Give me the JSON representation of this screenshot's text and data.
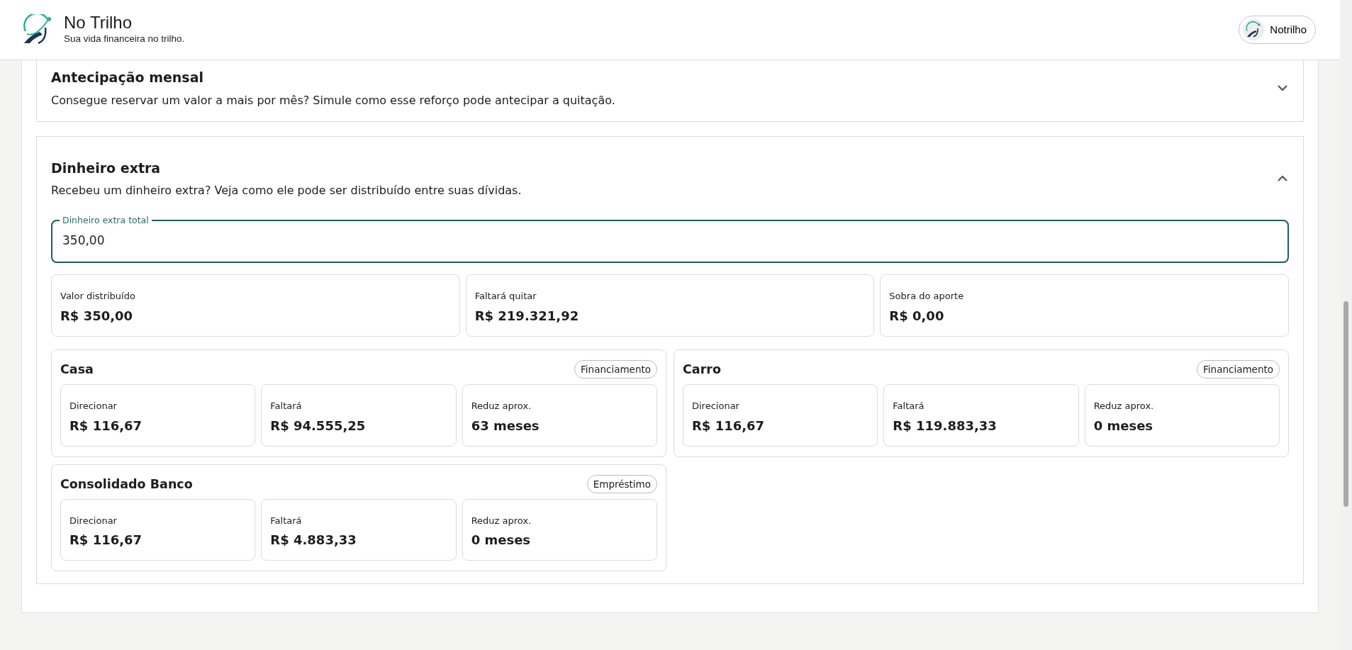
{
  "header": {
    "title": "No Trilho",
    "subtitle": "Sua vida financeira no trilho.",
    "user_button": {
      "label": "Notrilho"
    }
  },
  "sections": [
    {
      "title": "Antecipação mensal",
      "description": "Consegue reservar um valor a mais por mês? Simule como esse reforço pode antecipar a quitação.",
      "expanded": false
    },
    {
      "title": "Dinheiro extra",
      "description": "Recebeu um dinheiro extra? Veja como ele pode ser distribuído entre suas dívidas.",
      "expanded": true,
      "field": {
        "label": "Dinheiro extra total",
        "value": "350,00"
      },
      "summary": [
        {
          "label": "Valor distribuído",
          "value": "R$ 350,00"
        },
        {
          "label": "Faltará quitar",
          "value": "R$ 219.321,92"
        },
        {
          "label": "Sobra do aporte",
          "value": "R$ 0,00"
        }
      ],
      "debts": [
        {
          "name": "Casa",
          "type": "Financiamento",
          "metrics": [
            {
              "label": "Direcionar",
              "value": "R$ 116,67"
            },
            {
              "label": "Faltará",
              "value": "R$ 94.555,25"
            },
            {
              "label": "Reduz aprox.",
              "value": "63 meses"
            }
          ]
        },
        {
          "name": "Carro",
          "type": "Financiamento",
          "metrics": [
            {
              "label": "Direcionar",
              "value": "R$ 116,67"
            },
            {
              "label": "Faltará",
              "value": "R$ 119.883,33"
            },
            {
              "label": "Reduz aprox.",
              "value": "0 meses"
            }
          ]
        },
        {
          "name": "Consolidado Banco",
          "type": "Empréstimo",
          "metrics": [
            {
              "label": "Direcionar",
              "value": "R$ 116,67"
            },
            {
              "label": "Faltará",
              "value": "R$ 4.883,33"
            },
            {
              "label": "Reduz aprox.",
              "value": "0 meses"
            }
          ]
        }
      ]
    }
  ]
}
